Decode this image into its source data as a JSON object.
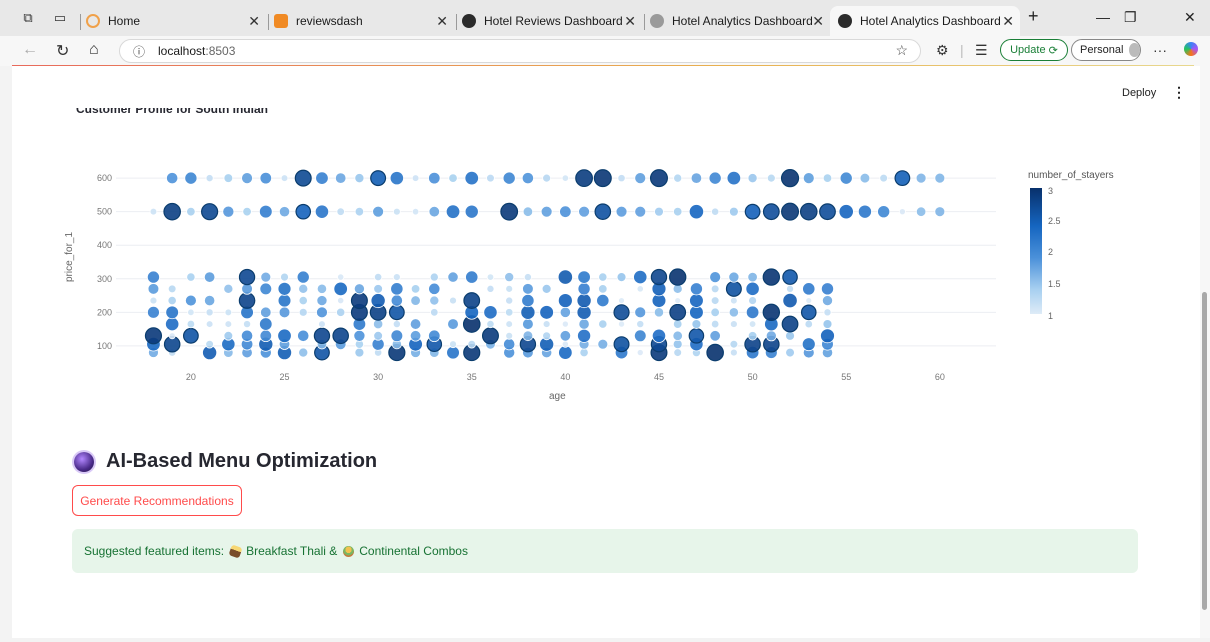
{
  "browser": {
    "tabs": [
      {
        "title": "Home",
        "fav": "#f0a14a"
      },
      {
        "title": "reviewsdash",
        "fav": "#f08a24"
      },
      {
        "title": "Hotel Reviews Dashboard",
        "fav": "#2b2b2b"
      },
      {
        "title": "Hotel Analytics Dashboard",
        "fav": "#9a9a9a"
      },
      {
        "title": "Hotel Analytics Dashboard",
        "fav": "#2b2b2b",
        "active": true
      }
    ],
    "address": {
      "host": "localhost",
      "port": ":8503"
    },
    "update_label": "Update",
    "profile_label": "Personal"
  },
  "app": {
    "deploy_label": "Deploy"
  },
  "chart": {
    "title": "Customer Profile for South Indian",
    "legend_title": "number_of_stayers",
    "legend_ticks": [
      "3",
      "2.5",
      "2",
      "1.5",
      "1"
    ],
    "colors": {
      "low": "#deebf7",
      "mid": "#4a90d9",
      "high": "#08306b"
    }
  },
  "chart_data": {
    "type": "scatter",
    "title": "Customer Profile for South Indian",
    "xlabel": "age",
    "ylabel": "price_for_1",
    "x_ticks": [
      20,
      25,
      30,
      35,
      40,
      45,
      50,
      55,
      60
    ],
    "y_ticks": [
      100,
      200,
      300,
      400,
      500,
      600
    ],
    "xlim": [
      16,
      63
    ],
    "ylim": [
      40,
      660
    ],
    "color_by": "number_of_stayers",
    "color_range": [
      1,
      3
    ],
    "bands": [
      {
        "price": 600,
        "ages": [
          19,
          20,
          21,
          22,
          23,
          24,
          25,
          26,
          27,
          28,
          29,
          30,
          31,
          32,
          33,
          34,
          35,
          36,
          37,
          38,
          39,
          40,
          41,
          42,
          43,
          44,
          45,
          46,
          47,
          48,
          49,
          50,
          51,
          52,
          53,
          54,
          55,
          56,
          57,
          58,
          59,
          60
        ]
      },
      {
        "price": 500,
        "ages": [
          18,
          19,
          20,
          21,
          22,
          23,
          24,
          25,
          26,
          27,
          28,
          29,
          30,
          31,
          32,
          33,
          34,
          35,
          37,
          38,
          39,
          40,
          41,
          42,
          43,
          44,
          45,
          46,
          47,
          48,
          49,
          50,
          51,
          52,
          53,
          54,
          55,
          56,
          57,
          58,
          59,
          60
        ]
      },
      {
        "price": 300,
        "price_spread": [
          60,
          320
        ],
        "ages": [
          18,
          19,
          20,
          21,
          22,
          23,
          24,
          25,
          26,
          27,
          28,
          29,
          30,
          31,
          32,
          33,
          34,
          35,
          36,
          37,
          38,
          39,
          40,
          41,
          42,
          43,
          44,
          45,
          46,
          47,
          48,
          49,
          50,
          51,
          52,
          53,
          54
        ]
      }
    ]
  },
  "section": {
    "title": "AI-Based Menu Optimization",
    "button_label": "Generate Recommendations",
    "alert_prefix": "Suggested featured items:",
    "item1": "Breakfast Thali &",
    "item2": "Continental Combos"
  }
}
